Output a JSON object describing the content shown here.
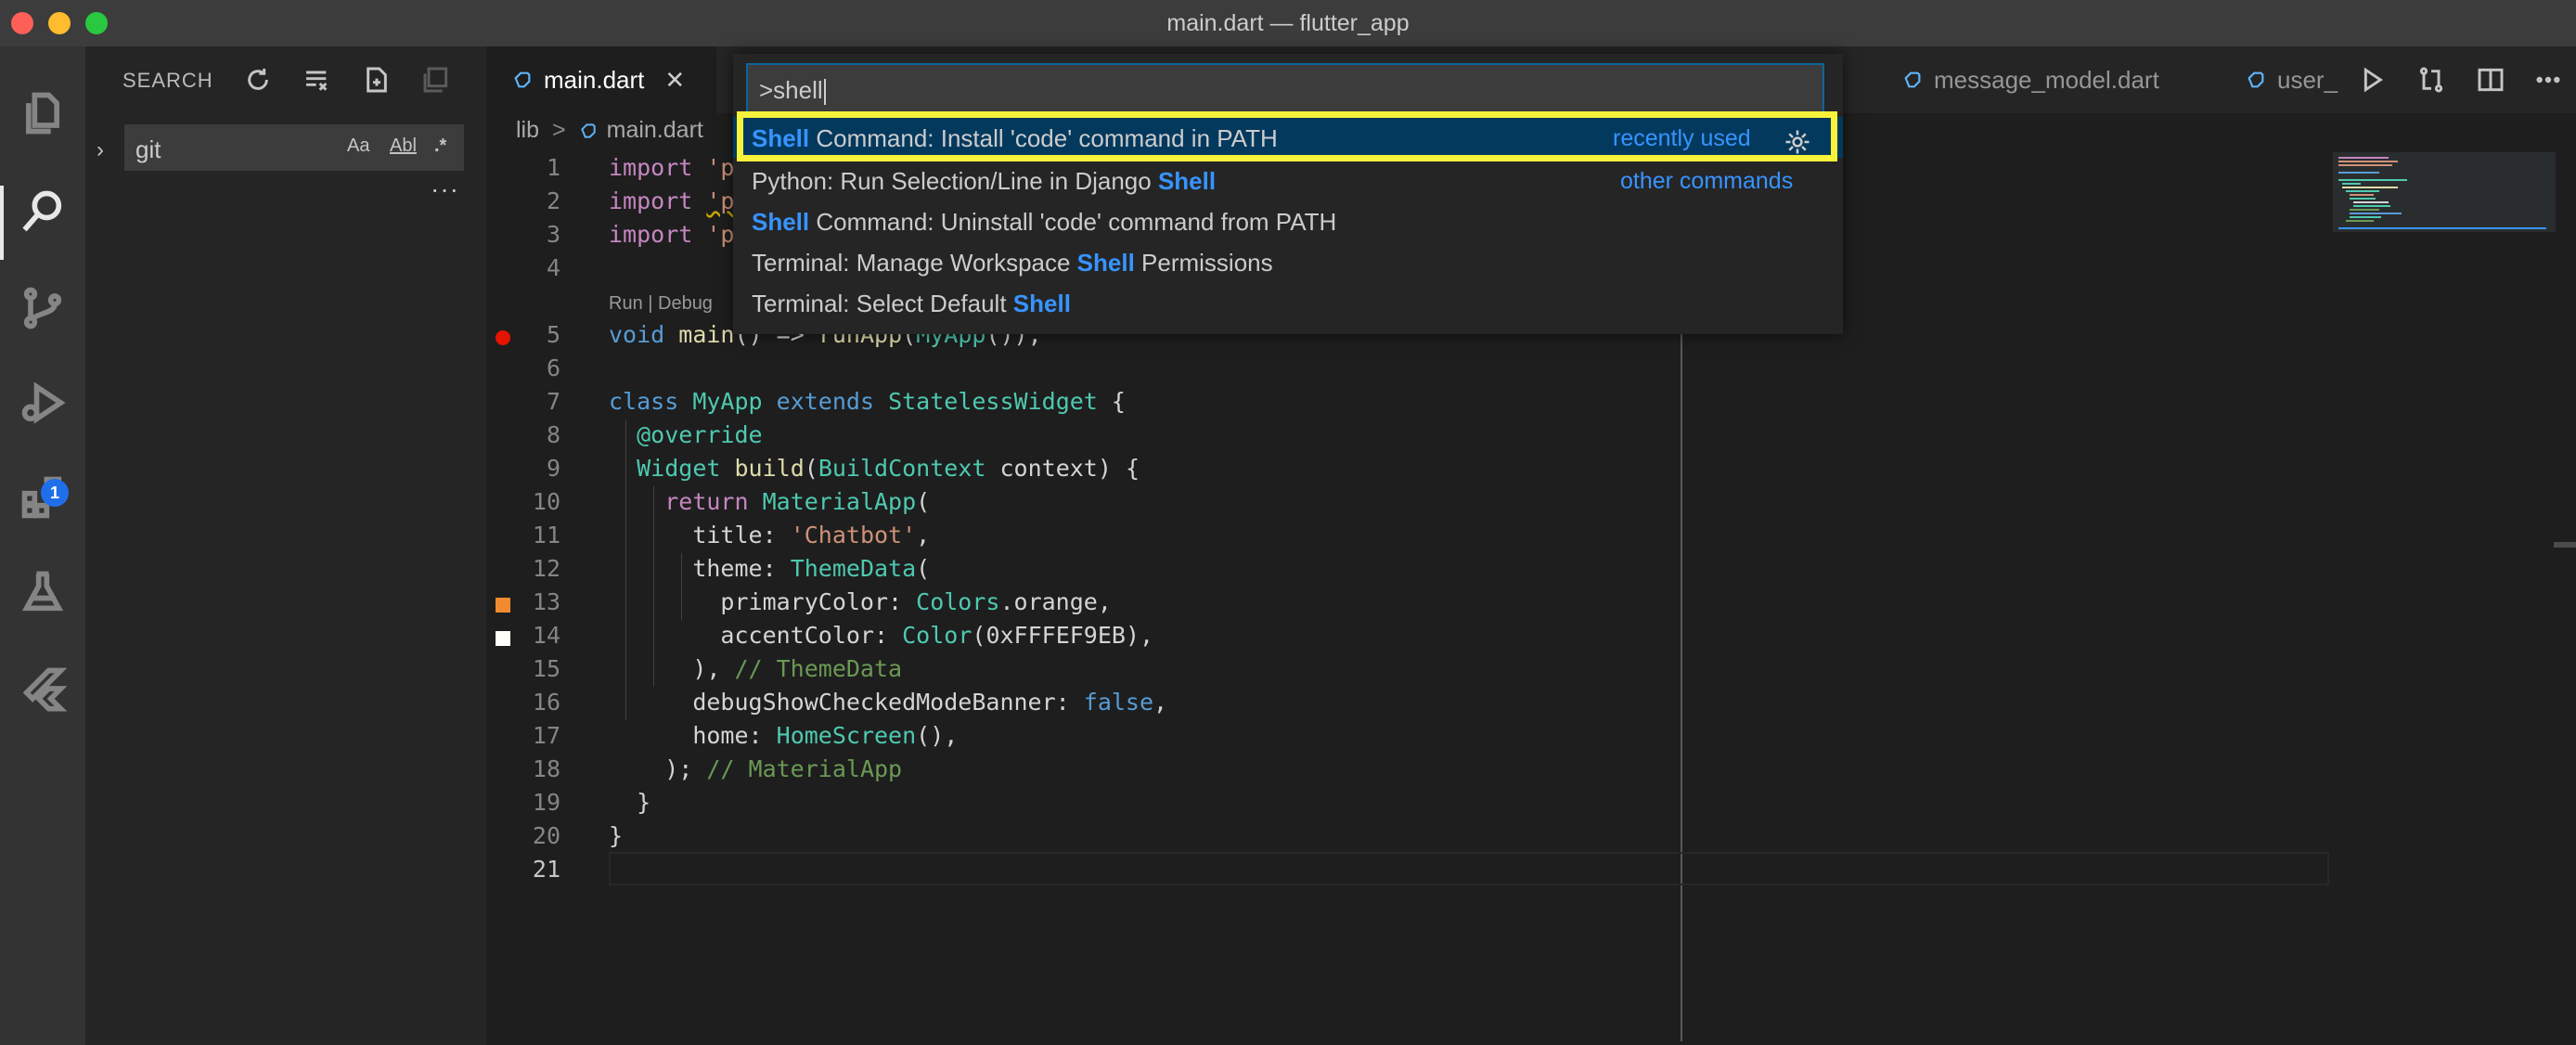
{
  "window": {
    "title": "main.dart — flutter_app"
  },
  "activity_bar": {
    "extensions_badge": "1"
  },
  "sidebar": {
    "title": "SEARCH",
    "search_value": "git",
    "opt_case": "Aa",
    "opt_word": "Abl",
    "opt_regex": ".*",
    "more": "···"
  },
  "tabs": [
    {
      "label": "main.dart",
      "close": "✕"
    },
    {
      "label": "message_model.dart"
    },
    {
      "label": "user_"
    }
  ],
  "breadcrumb": {
    "folder": "lib",
    "sep": ">",
    "file": "main.dart"
  },
  "palette": {
    "input": ">shell",
    "items": [
      {
        "hl": "Shell",
        "rest": " Command: Install 'code' command in PATH",
        "hint": "recently used"
      },
      {
        "pre": "Python: Run Selection/Line in Django ",
        "hl": "Shell",
        "hint": "other commands"
      },
      {
        "hl": "Shell",
        "rest": " Command: Uninstall 'code' command from PATH"
      },
      {
        "pre": "Terminal: Manage Workspace ",
        "hl": "Shell",
        "rest": " Permissions"
      },
      {
        "pre": "Terminal: Select Default ",
        "hl": "Shell"
      }
    ]
  },
  "editor": {
    "codelens": "Run | Debug",
    "line_numbers": [
      "1",
      "2",
      "3",
      "4",
      "5",
      "6",
      "7",
      "8",
      "9",
      "10",
      "11",
      "12",
      "13",
      "14",
      "15",
      "16",
      "17",
      "18",
      "19",
      "20",
      "21"
    ],
    "tokens": {
      "import": "import",
      "imp_str": "'p",
      "void": "void",
      "main": "main",
      "arrow": "() => ",
      "runApp": "runApp",
      "myapp_call": "MyApp",
      "end5": "());",
      "class": "class",
      "MyApp": "MyApp",
      "extends": "extends",
      "StatelessWidget": "StatelessWidget",
      "brace_open": " {",
      "override": "@override",
      "Widget": "Widget",
      "build": "build",
      "paren_open": "(",
      "BuildContext": "BuildContext",
      "context_rest": " context) {",
      "return": "return",
      "MaterialApp": "MaterialApp",
      "title": "title",
      "colon": ": ",
      "chatbot": "'Chatbot'",
      "comma": ",",
      "theme": "theme",
      "ThemeData": "ThemeData",
      "primaryColor": "primaryColor",
      "Colors": "Colors",
      "orange": ".orange,",
      "accentColor": "accentColor",
      "Color": "Color",
      "hex": "0xFFFEF9EB",
      "close_paren_comma": "),",
      "c_themedata": " // ThemeData",
      "debugBanner": "debugShowCheckedModeBanner",
      "false": "false",
      "home": "home",
      "HomeScreen": "HomeScreen",
      "call_comma": "(),",
      "close_semi": ");",
      "c_materialapp": " // MaterialApp",
      "brace_close": "}"
    }
  },
  "colors": {
    "accent": "#3794ff",
    "highlight_box": "#f7f23a",
    "primary_color_swatch": "#f28b30",
    "accent_color_swatch": "#fffef9"
  }
}
